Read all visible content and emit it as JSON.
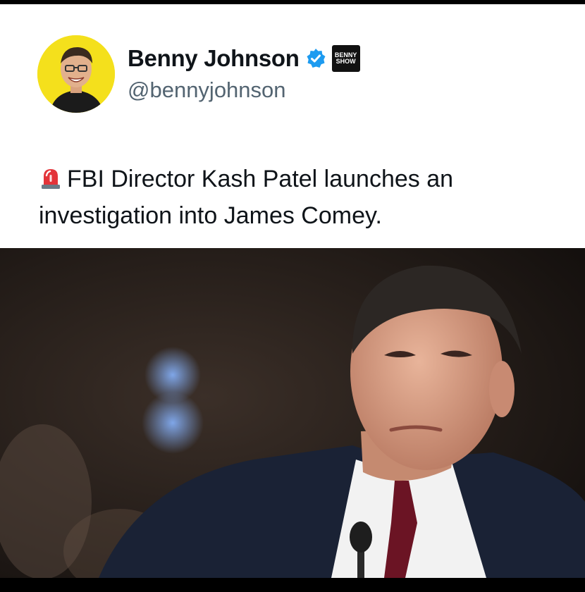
{
  "post": {
    "author_name": "Benny Johnson",
    "author_handle": "@bennyjohnson",
    "badge_text_line1": "BENNY",
    "badge_text_line2": "SHOW",
    "body_text": "FBI Director Kash Patel launches an investigation into James Comey.",
    "alert_icon": "police-siren-icon",
    "verified_icon": "verified-check-icon",
    "accent_color": "#1d9bf0"
  },
  "media": {
    "subject": "man in suit at hearing with microphone"
  }
}
